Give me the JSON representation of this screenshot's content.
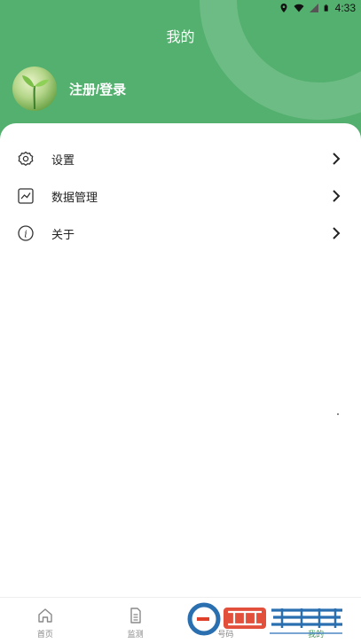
{
  "status_bar": {
    "time": "4:33"
  },
  "header": {
    "title": "我的",
    "login_label": "注册/登录"
  },
  "menu": [
    {
      "label": "设置",
      "icon": "settings-icon"
    },
    {
      "label": "数据管理",
      "icon": "chart-icon"
    },
    {
      "label": "关于",
      "icon": "info-icon"
    }
  ],
  "tabbar": [
    {
      "label": "首页",
      "icon": "home-icon",
      "active": false
    },
    {
      "label": "监测",
      "icon": "document-icon",
      "active": false
    },
    {
      "label": "号码",
      "icon": "",
      "active": false
    },
    {
      "label": "我的",
      "icon": "",
      "active": true
    }
  ],
  "colors": {
    "primary": "#53b06e",
    "active_tab": "#3f9f5a"
  }
}
